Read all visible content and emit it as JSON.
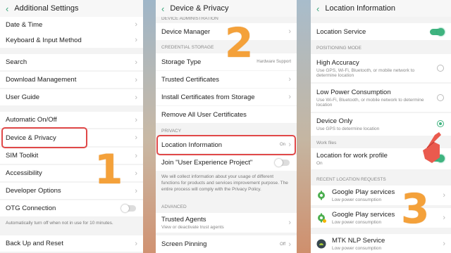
{
  "panel1": {
    "title": "Additional Settings",
    "items": {
      "date_time": "Date & Time",
      "keyboard": "Keyboard & Input Method",
      "search": "Search",
      "download": "Download Management",
      "guide": "User Guide",
      "auto_onoff": "Automatic On/Off",
      "device_privacy": "Device & Privacy",
      "sim": "SIM Toolkit",
      "accessibility": "Accessibility",
      "developer": "Developer Options",
      "otg": "OTG Connection",
      "otg_note": "Automatically turn off when not in use for 10 minutes.",
      "backup": "Back Up and Reset"
    },
    "step_number": "1"
  },
  "panel2": {
    "title": "Device & Privacy",
    "section_top": "DEVICE ADMINISTRATION",
    "device_manager": "Device Manager",
    "section_credential": "CREDENTIAL STORAGE",
    "storage_type": "Storage Type",
    "storage_type_value": "Hardware Support",
    "trusted_certs": "Trusted Certificates",
    "install_certs": "Install Certificates from Storage",
    "remove_certs": "Remove All User Certificates",
    "section_privacy": "PRIVACY",
    "location_info": "Location Information",
    "location_value": "On",
    "join_project": "Join \"User Experience Project\"",
    "privacy_note": "We will collect information about your usage of different functions for products and services improvement purpose. The entire process will comply with the Privacy Policy.",
    "section_advanced": "ADVANCED",
    "trusted_agents": "Trusted Agents",
    "trusted_agents_sub": "View or deactivate trust agents",
    "screen_pinning": "Screen Pinning",
    "screen_pinning_value": "Off",
    "step_number": "2"
  },
  "panel3": {
    "title": "Location Information",
    "location_service": "Location Service",
    "section_mode": "POSITIONING MODE",
    "high_accuracy": "High Accuracy",
    "high_accuracy_sub": "Use GPS, Wi-Fi, Bluetooth, or mobile network to determine location",
    "low_power": "Low Power Consumption",
    "low_power_sub": "Use Wi-Fi, Bluetooth, or mobile network to determine location",
    "device_only": "Device Only",
    "device_only_sub": "Use GPS to determine location",
    "section_work": "Work files",
    "work_profile": "Location for work profile",
    "work_profile_sub": "On",
    "section_recent": "RECENT LOCATION REQUESTS",
    "apps": [
      {
        "name": "Google Play services",
        "sub": "Low power consumption"
      },
      {
        "name": "Google Play services",
        "sub": "Low power consumption"
      },
      {
        "name": "MTK NLP Service",
        "sub": "Low power consumption"
      }
    ],
    "step_number": "3"
  },
  "colors": {
    "accent": "#3fb37f",
    "highlight": "#e04848",
    "step": "#f4a13a"
  }
}
